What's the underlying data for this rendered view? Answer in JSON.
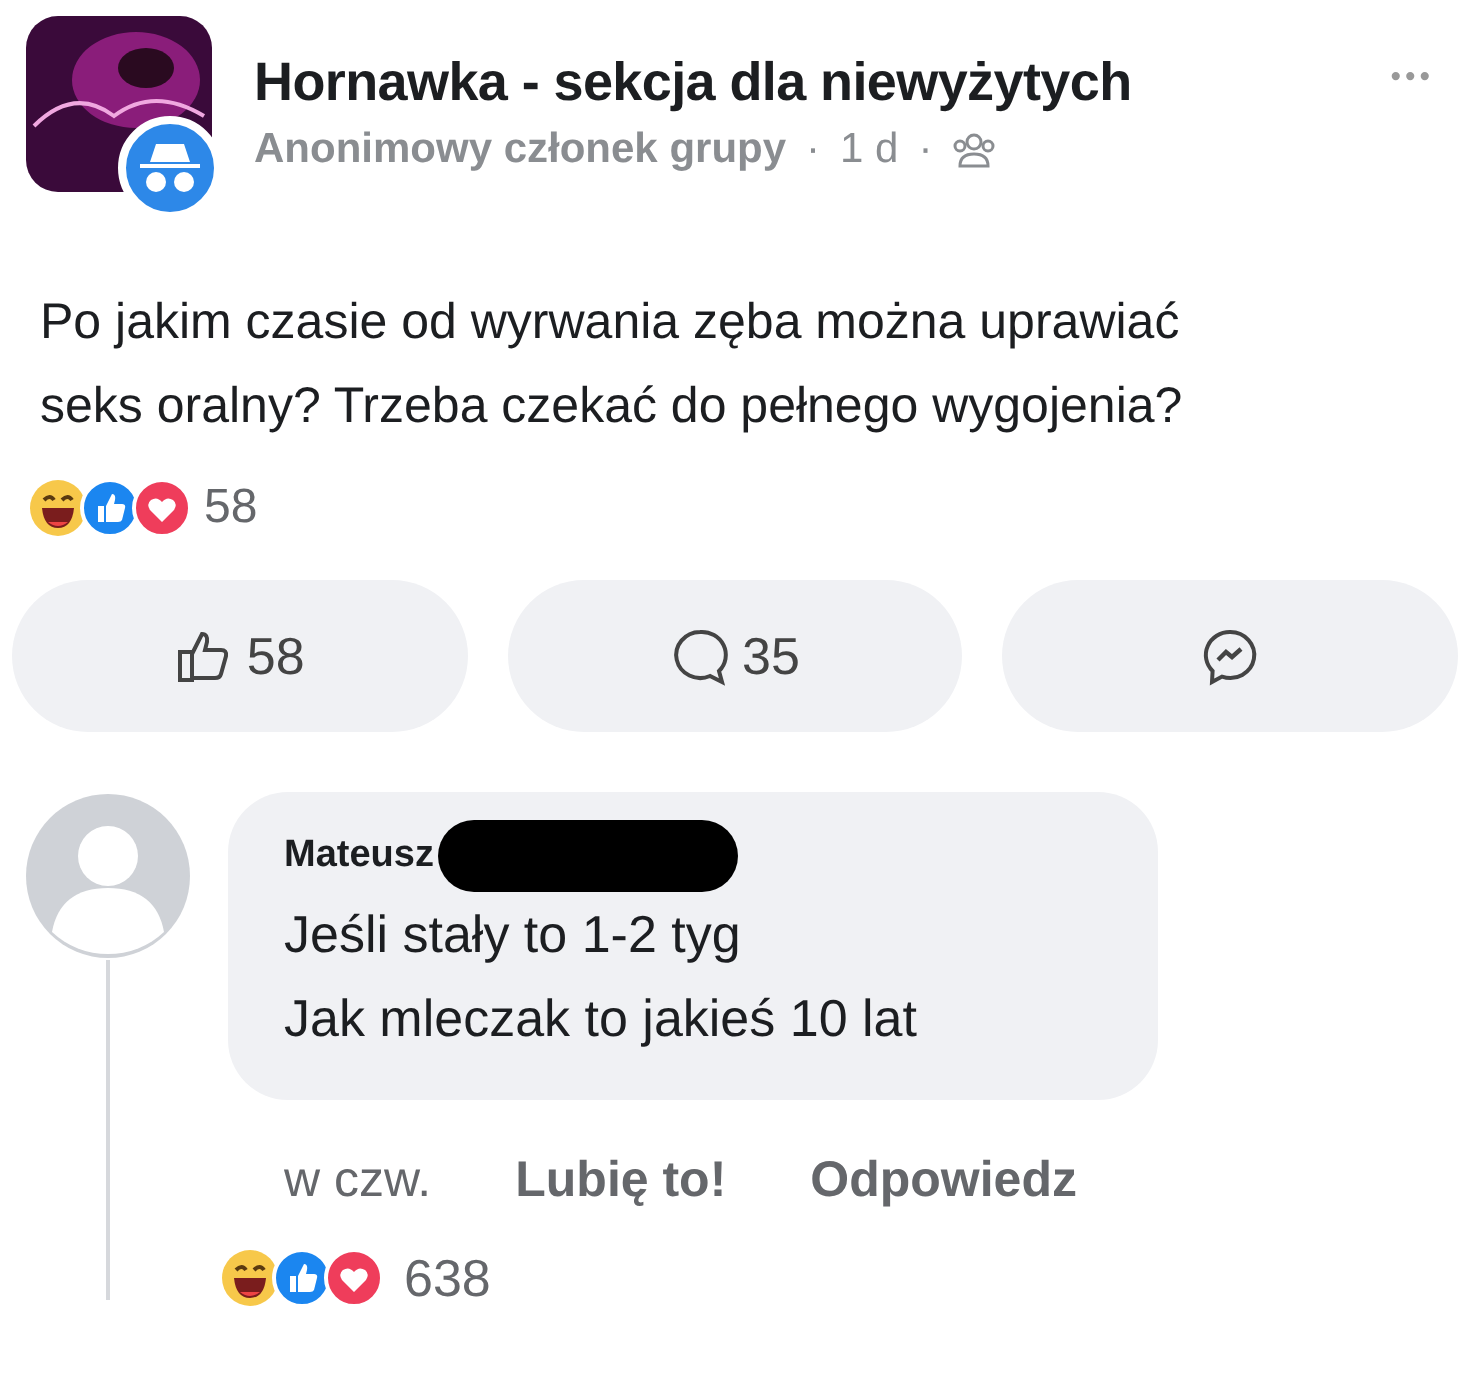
{
  "post": {
    "group_name": "Hornawka - sekcja dla niewyżytych",
    "author": "Anonimowy członek grupy",
    "time": "1 d",
    "separator_1": "·",
    "separator_2": "·",
    "more": "•••",
    "text": "Po jakim czasie od wyrwania zęba można uprawiać seks oralny? Trzeba czekać do pełnego wygojenia?",
    "reaction_count": "58"
  },
  "actions": [
    {
      "kind": "like",
      "label": "58"
    },
    {
      "kind": "comment",
      "label": "35"
    },
    {
      "kind": "share"
    }
  ],
  "comment": {
    "author": "Mateusz",
    "redacted": true,
    "lines": [
      "Jeśli stały to 1-2 tyg",
      "Jak mleczak to jakieś 10 lat"
    ],
    "time": "w czw.",
    "like_label": "Lubię to!",
    "reply_label": "Odpowiedz",
    "reaction_count": "638"
  }
}
